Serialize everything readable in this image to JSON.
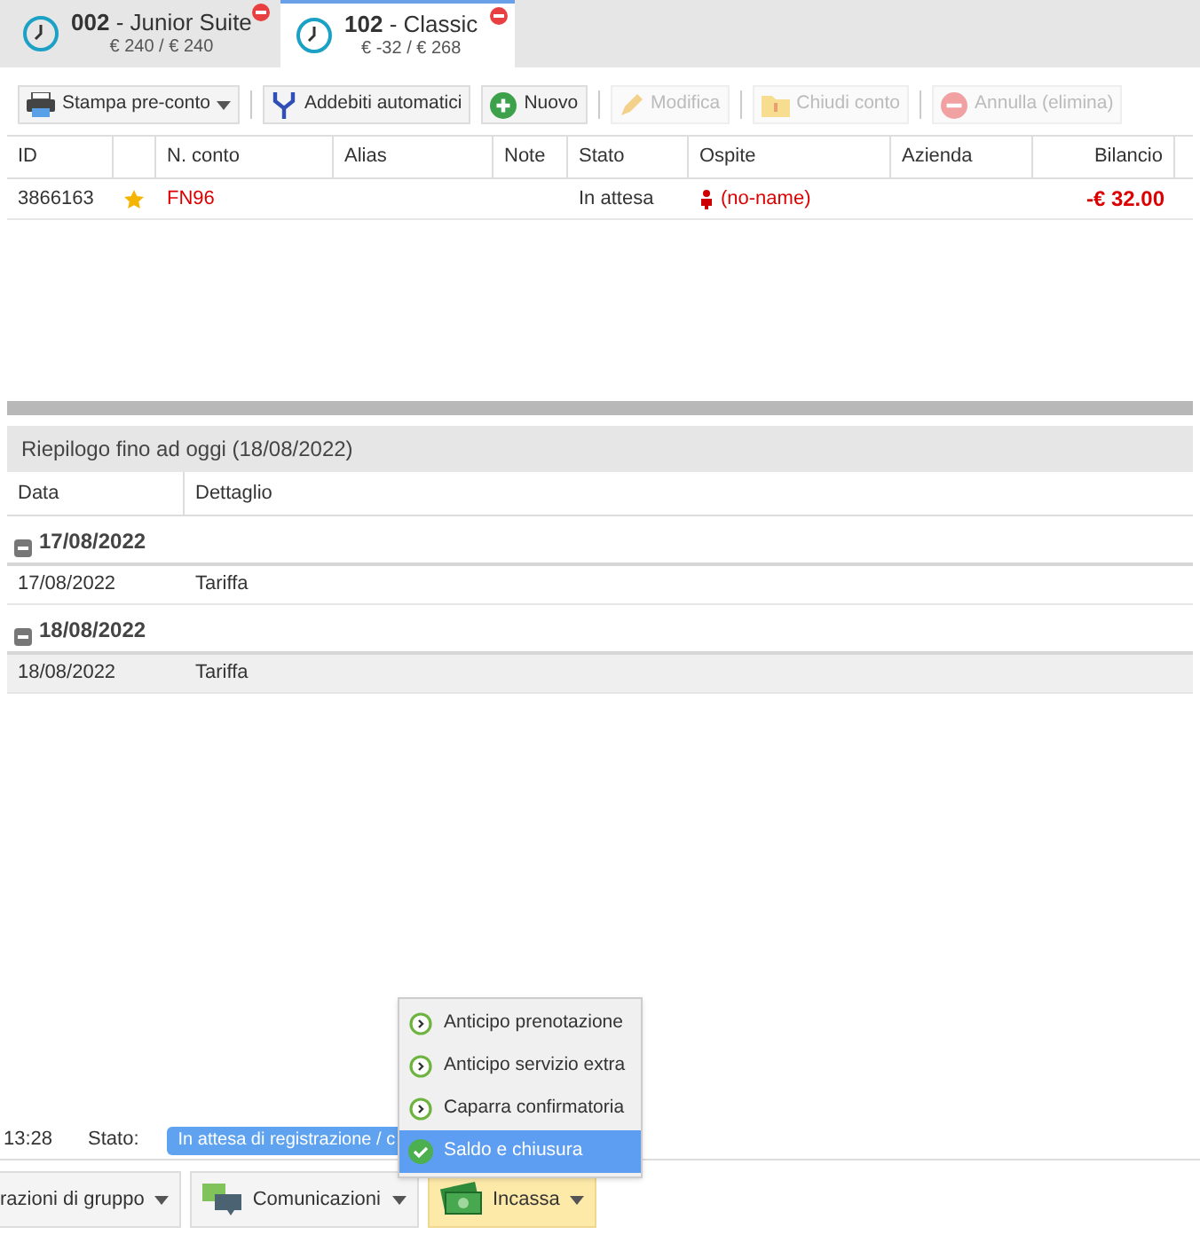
{
  "tabs": [
    {
      "title": "**002** - Junior Suite",
      "amounts": "€ 240 / € 240",
      "selected": false
    },
    {
      "title": "**102** - Classic",
      "amounts": "€ -32 / € 268",
      "selected": true
    }
  ],
  "toolbar": [
    {
      "label": "Stampa pre-conto",
      "kind": "print",
      "dropdown": true,
      "disabled": false
    },
    {
      "label": "Addebiti automatici",
      "kind": "fork",
      "dropdown": false,
      "disabled": false
    },
    {
      "label": "Nuovo",
      "kind": "add",
      "dropdown": false,
      "disabled": false
    },
    {
      "label": "Modifica",
      "kind": "edit",
      "dropdown": false,
      "disabled": true
    },
    {
      "label": "Chiudi conto",
      "kind": "folder",
      "dropdown": false,
      "disabled": true
    },
    {
      "label": "Annulla (elimina)",
      "kind": "remove",
      "dropdown": false,
      "disabled": true
    }
  ],
  "table": {
    "columns": [
      "ID",
      "",
      "N. conto",
      "Alias",
      "Note",
      "Stato",
      "Ospite",
      "Azienda",
      "Bilancio"
    ],
    "rows": [
      {
        "id": "3866163",
        "starred": true,
        "account": "FN96",
        "alias": "",
        "note": "",
        "status": "In attesa",
        "guest": "(no-name)",
        "company": "",
        "balance": "-€ 32.00"
      }
    ]
  },
  "summary": {
    "title": "Riepilogo fino ad oggi (18/08/2022)",
    "columns": [
      "Data",
      "Dettaglio"
    ],
    "groups": [
      {
        "label": "17/08/2022",
        "expanded": true,
        "rows": [
          {
            "date": "17/08/2022",
            "detail": "Tariffa",
            "selected": false
          }
        ]
      },
      {
        "label": "18/08/2022",
        "expanded": true,
        "rows": [
          {
            "date": "18/08/2022",
            "detail": "Tariffa",
            "selected": true
          }
        ]
      }
    ]
  },
  "status_bar": {
    "time": "13:28",
    "label": "Stato:",
    "badge": "In attesa di registrazione / c"
  },
  "bottom_buttons": [
    {
      "label": "razioni di gruppo",
      "kind": "plain",
      "open": false
    },
    {
      "label": "Comunicazioni",
      "kind": "chat",
      "open": false
    },
    {
      "label": "Incassa",
      "kind": "cash",
      "open": true
    }
  ],
  "menu": [
    {
      "label": "Anticipo prenotazione",
      "kind": "partial",
      "selected": false
    },
    {
      "label": "Anticipo servizio extra",
      "kind": "partial",
      "selected": false
    },
    {
      "label": "Caparra confirmatoria",
      "kind": "partial",
      "selected": false
    },
    {
      "label": "Saldo e chiusura",
      "kind": "final",
      "selected": true
    }
  ]
}
